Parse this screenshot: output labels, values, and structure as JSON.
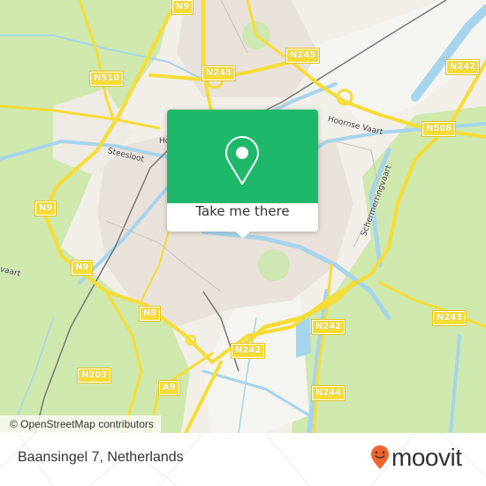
{
  "map": {
    "attribution": "© OpenStreetMap contributors",
    "colors": {
      "land": "#f2efe9",
      "urban": "#e8e0d8",
      "farmland": "#c8e6a0",
      "water": "#a6d4ec",
      "road": "#f6dc35",
      "rail": "#777777",
      "shield": "#f6dc35"
    },
    "road_shields": [
      {
        "label": "N9"
      },
      {
        "label": "N245"
      },
      {
        "label": "N245"
      },
      {
        "label": "N242"
      },
      {
        "label": "N510"
      },
      {
        "label": "N508"
      },
      {
        "label": "N9"
      },
      {
        "label": "N9"
      },
      {
        "label": "N9"
      },
      {
        "label": "N242"
      },
      {
        "label": "N242"
      },
      {
        "label": "N243"
      },
      {
        "label": "N203"
      },
      {
        "label": "A9"
      },
      {
        "label": "N244"
      }
    ],
    "place_labels": [
      {
        "label": "Steesloot"
      },
      {
        "label": "Hoornse Vaart"
      },
      {
        "label": "Schermerringvaart"
      },
      {
        "label": "Ho"
      },
      {
        "label": "vaart"
      }
    ]
  },
  "popup": {
    "icon": "map-pin-icon",
    "accent_color": "#1eb86a",
    "cta_label": "Take me there"
  },
  "footer": {
    "address": "Baansingel 7, Netherlands",
    "brand": {
      "name": "moovit",
      "icon": "moovit-pin-icon",
      "color": "#f0642d"
    }
  }
}
